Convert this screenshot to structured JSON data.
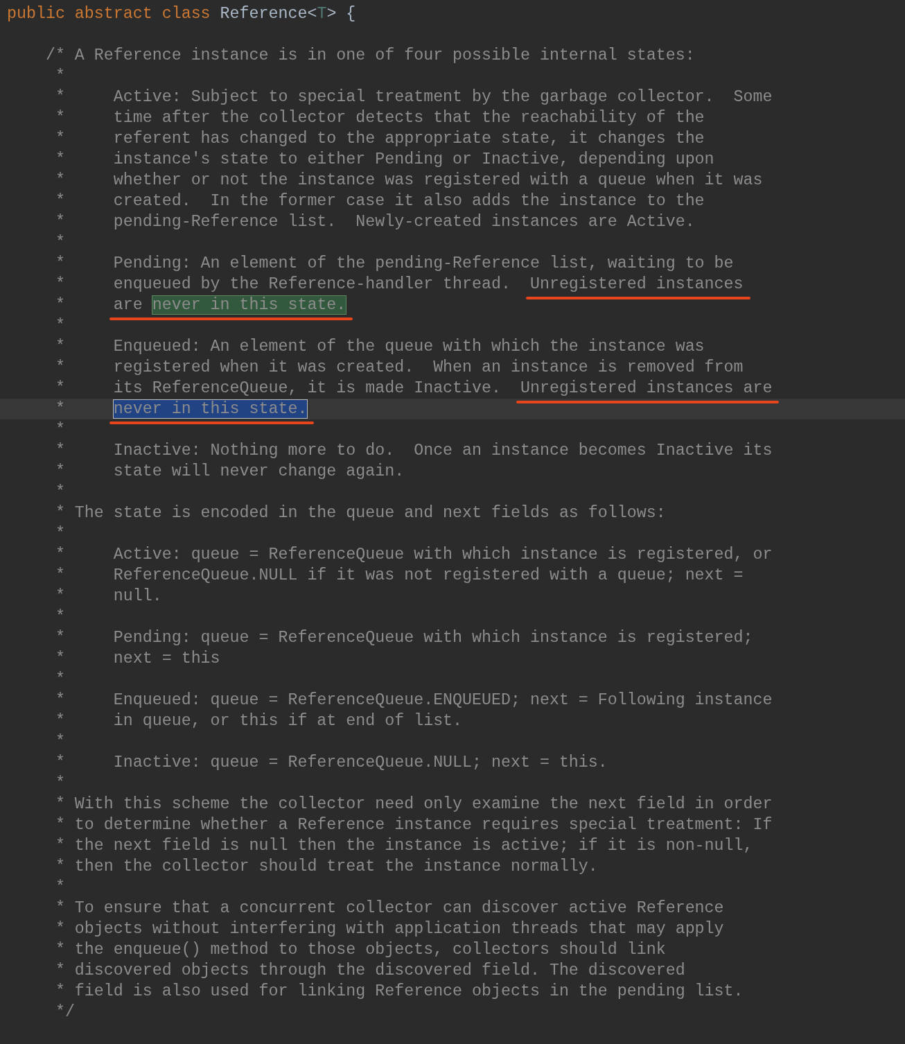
{
  "lines": [
    {
      "current": false,
      "segments": [
        {
          "kind": "keyword",
          "text": "public abstract class "
        },
        {
          "kind": "plain",
          "text": "Reference<"
        },
        {
          "kind": "type_param",
          "text": "T"
        },
        {
          "kind": "plain",
          "text": "> {"
        }
      ]
    },
    {
      "current": false
    },
    {
      "current": false,
      "segments": [
        {
          "kind": "comment",
          "text": "    /* A Reference instance is in one of four possible internal states:"
        }
      ]
    },
    {
      "current": false,
      "segments": [
        {
          "kind": "comment",
          "text": "     *"
        }
      ]
    },
    {
      "current": false,
      "segments": [
        {
          "kind": "comment",
          "text": "     *     Active: Subject to special treatment by the garbage collector.  Some"
        }
      ]
    },
    {
      "current": false,
      "segments": [
        {
          "kind": "comment",
          "text": "     *     time after the collector detects that the reachability of the"
        }
      ]
    },
    {
      "current": false,
      "segments": [
        {
          "kind": "comment",
          "text": "     *     referent has changed to the appropriate state, it changes the"
        }
      ]
    },
    {
      "current": false,
      "segments": [
        {
          "kind": "comment",
          "text": "     *     instance's state to either Pending or Inactive, depending upon"
        }
      ]
    },
    {
      "current": false,
      "segments": [
        {
          "kind": "comment",
          "text": "     *     whether or not the instance was registered with a queue when it was"
        }
      ]
    },
    {
      "current": false,
      "segments": [
        {
          "kind": "comment",
          "text": "     *     created.  In the former case it also adds the instance to the"
        }
      ]
    },
    {
      "current": false,
      "segments": [
        {
          "kind": "comment",
          "text": "     *     pending-Reference list.  Newly-created instances are Active."
        }
      ]
    },
    {
      "current": false,
      "segments": [
        {
          "kind": "comment",
          "text": "     *"
        }
      ]
    },
    {
      "current": false,
      "segments": [
        {
          "kind": "comment",
          "text": "     *     Pending: An element of the pending-Reference list, waiting to be"
        }
      ]
    },
    {
      "current": false,
      "segments": [
        {
          "kind": "comment",
          "text": "     *     enqueued by the Reference-handler thread.  "
        },
        {
          "kind": "comment",
          "text": "Unregistered instances",
          "underlined": true
        }
      ]
    },
    {
      "current": false,
      "segments": [
        {
          "kind": "comment",
          "text": "     *     "
        },
        {
          "kind": "comment",
          "text": "are ",
          "underlined": true
        },
        {
          "kind": "search_match",
          "text": "never in this state.",
          "underlined": true
        }
      ]
    },
    {
      "current": false,
      "segments": [
        {
          "kind": "comment",
          "text": "     *"
        }
      ]
    },
    {
      "current": false,
      "segments": [
        {
          "kind": "comment",
          "text": "     *     Enqueued: An element of the queue with which the instance was"
        }
      ]
    },
    {
      "current": false,
      "segments": [
        {
          "kind": "comment",
          "text": "     *     registered when it was created.  When an instance is removed from"
        }
      ]
    },
    {
      "current": false,
      "segments": [
        {
          "kind": "comment",
          "text": "     *     its ReferenceQueue, it is made Inactive.  "
        },
        {
          "kind": "comment",
          "text": "Unregistered instances are",
          "underlined": true
        }
      ]
    },
    {
      "current": true,
      "segments": [
        {
          "kind": "comment",
          "text": "     *     "
        },
        {
          "kind": "selection",
          "text": "never in this state.",
          "underlined": true
        }
      ]
    },
    {
      "current": false,
      "segments": [
        {
          "kind": "comment",
          "text": "     *"
        }
      ]
    },
    {
      "current": false,
      "segments": [
        {
          "kind": "comment",
          "text": "     *     Inactive: Nothing more to do.  Once an instance becomes Inactive its"
        }
      ]
    },
    {
      "current": false,
      "segments": [
        {
          "kind": "comment",
          "text": "     *     state will never change again."
        }
      ]
    },
    {
      "current": false,
      "segments": [
        {
          "kind": "comment",
          "text": "     *"
        }
      ]
    },
    {
      "current": false,
      "segments": [
        {
          "kind": "comment",
          "text": "     * The state is encoded in the queue and next fields as follows:"
        }
      ]
    },
    {
      "current": false,
      "segments": [
        {
          "kind": "comment",
          "text": "     *"
        }
      ]
    },
    {
      "current": false,
      "segments": [
        {
          "kind": "comment",
          "text": "     *     Active: queue = ReferenceQueue with which instance is registered, or"
        }
      ]
    },
    {
      "current": false,
      "segments": [
        {
          "kind": "comment",
          "text": "     *     ReferenceQueue.NULL if it was not registered with a queue; next ="
        }
      ]
    },
    {
      "current": false,
      "segments": [
        {
          "kind": "comment",
          "text": "     *     null."
        }
      ]
    },
    {
      "current": false,
      "segments": [
        {
          "kind": "comment",
          "text": "     *"
        }
      ]
    },
    {
      "current": false,
      "segments": [
        {
          "kind": "comment",
          "text": "     *     Pending: queue = ReferenceQueue with which instance is registered;"
        }
      ]
    },
    {
      "current": false,
      "segments": [
        {
          "kind": "comment",
          "text": "     *     next = this"
        }
      ]
    },
    {
      "current": false,
      "segments": [
        {
          "kind": "comment",
          "text": "     *"
        }
      ]
    },
    {
      "current": false,
      "segments": [
        {
          "kind": "comment",
          "text": "     *     Enqueued: queue = ReferenceQueue.ENQUEUED; next = Following instance"
        }
      ]
    },
    {
      "current": false,
      "segments": [
        {
          "kind": "comment",
          "text": "     *     in queue, or this if at end of list."
        }
      ]
    },
    {
      "current": false,
      "segments": [
        {
          "kind": "comment",
          "text": "     *"
        }
      ]
    },
    {
      "current": false,
      "segments": [
        {
          "kind": "comment",
          "text": "     *     Inactive: queue = ReferenceQueue.NULL; next = this."
        }
      ]
    },
    {
      "current": false,
      "segments": [
        {
          "kind": "comment",
          "text": "     *"
        }
      ]
    },
    {
      "current": false,
      "segments": [
        {
          "kind": "comment",
          "text": "     * With this scheme the collector need only examine the next field in order"
        }
      ]
    },
    {
      "current": false,
      "segments": [
        {
          "kind": "comment",
          "text": "     * to determine whether a Reference instance requires special treatment: If"
        }
      ]
    },
    {
      "current": false,
      "segments": [
        {
          "kind": "comment",
          "text": "     * the next field is null then the instance is active; if it is non-null,"
        }
      ]
    },
    {
      "current": false,
      "segments": [
        {
          "kind": "comment",
          "text": "     * then the collector should treat the instance normally."
        }
      ]
    },
    {
      "current": false,
      "segments": [
        {
          "kind": "comment",
          "text": "     *"
        }
      ]
    },
    {
      "current": false,
      "segments": [
        {
          "kind": "comment",
          "text": "     * To ensure that a concurrent collector can discover active Reference"
        }
      ]
    },
    {
      "current": false,
      "segments": [
        {
          "kind": "comment",
          "text": "     * objects without interfering with application threads that may apply"
        }
      ]
    },
    {
      "current": false,
      "segments": [
        {
          "kind": "comment",
          "text": "     * the enqueue() method to those objects, collectors should link"
        }
      ]
    },
    {
      "current": false,
      "segments": [
        {
          "kind": "comment",
          "text": "     * discovered objects through the discovered field. The discovered"
        }
      ]
    },
    {
      "current": false,
      "segments": [
        {
          "kind": "comment",
          "text": "     * field is also used for linking Reference objects in the pending list."
        }
      ]
    },
    {
      "current": false,
      "segments": [
        {
          "kind": "comment",
          "text": "     */"
        }
      ]
    }
  ]
}
